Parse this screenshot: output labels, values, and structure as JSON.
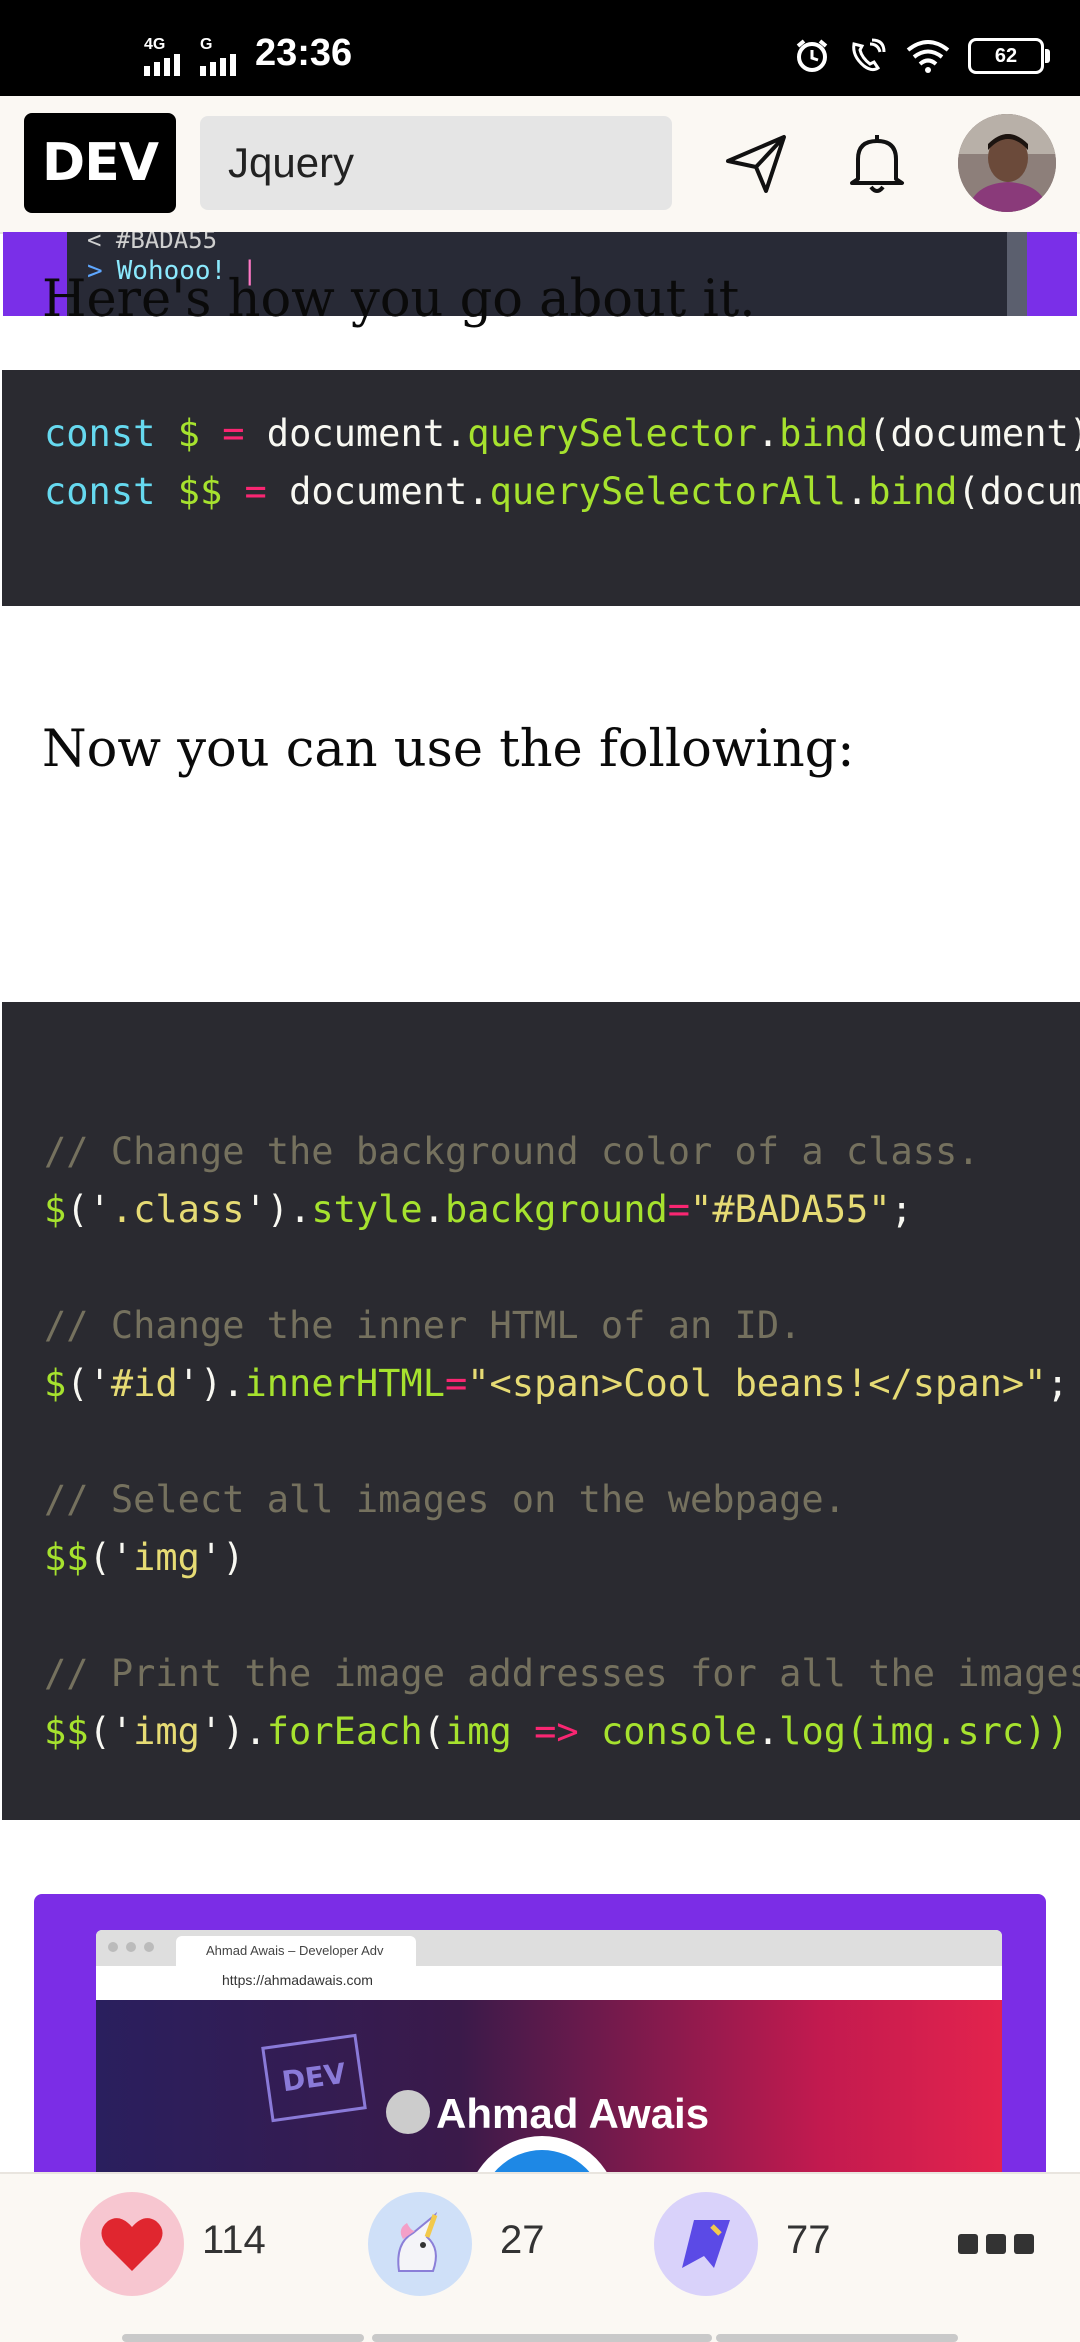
{
  "status_bar": {
    "time": "23:36",
    "network_labels": [
      "4G",
      "G"
    ],
    "battery": "62"
  },
  "header": {
    "logo_text": "DEV",
    "search_value": "Jquery"
  },
  "terminal": {
    "line1": "<  #BADA55",
    "prompt": ">",
    "output": "Wohooo!",
    "cursor": "|"
  },
  "article": {
    "para1": "Here's how you go about it.",
    "para2": "Now you can use the following:"
  },
  "code1": {
    "line1": {
      "kw": "const",
      "var": "$",
      "op": "=",
      "obj": "document",
      "dot": ".",
      "m1": "querySelector",
      "dot2": ".",
      "m2": "bind",
      "rest": "(document)"
    },
    "line2": {
      "kw": "const",
      "var": "$$",
      "op": "=",
      "obj": "document",
      "dot": ".",
      "m1": "querySelectorAll",
      "dot2": ".",
      "m2": "bind",
      "rest": "(docum"
    }
  },
  "code2": {
    "c1": "// Change the background color of a class.",
    "l1": {
      "a": "$",
      "b": "('",
      "c": ".class",
      "d": "').",
      "e": "style",
      "f": ".",
      "g": "background",
      "h": "=",
      "i": "\"#BADA55\"",
      "j": ";"
    },
    "c2": "// Change the inner HTML of an ID.",
    "l2": {
      "a": "$",
      "b": "('",
      "c": "#id",
      "d": "').",
      "e": "innerHTML",
      "f": "=",
      "g": "\"<span>Cool beans!</span>\"",
      "h": ";"
    },
    "c3": "// Select all images on the webpage.",
    "l3": {
      "a": "$$",
      "b": "('",
      "c": "img",
      "d": "')"
    },
    "c4": "// Print the image addresses for all the images",
    "l4": {
      "a": "$$",
      "b": "('",
      "c": "img",
      "d": "').",
      "e": "forEach",
      "f": "(",
      "g": "img",
      "h": "=>",
      "i": "console",
      "j": ".",
      "k": "log",
      "l": "(img.src))"
    }
  },
  "embed": {
    "tab_title": "Ahmad Awais – Developer Adv",
    "url": "https://ahmadawais.com",
    "hero_name": "Ahmad Awais",
    "badge": "DEV"
  },
  "reactions": {
    "hearts": "114",
    "unicorns": "27",
    "saves": "77"
  },
  "colors": {
    "accent_purple": "#7b2de6",
    "code_bg": "#2a2a30"
  }
}
